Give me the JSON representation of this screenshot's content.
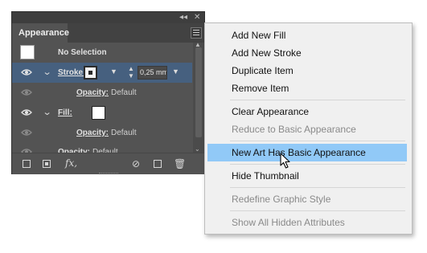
{
  "panel": {
    "tab_label": "Appearance",
    "collapse_glyph": "◂◂",
    "close_glyph": "✕",
    "rows": {
      "selection_label": "No Selection",
      "stroke_label": "Stroke:",
      "stroke_weight": "0,25 mm",
      "stroke_opacity_label": "Opacity:",
      "stroke_opacity_value": "Default",
      "fill_label": "Fill:",
      "fill_opacity_label": "Opacity:",
      "fill_opacity_value": "Default",
      "overall_opacity_label": "Opacity:",
      "overall_opacity_value": "Default"
    },
    "bottom_fx": "fx,"
  },
  "menu": {
    "add_new_fill": "Add New Fill",
    "add_new_stroke": "Add New Stroke",
    "duplicate_item": "Duplicate Item",
    "remove_item": "Remove Item",
    "clear_appearance": "Clear Appearance",
    "reduce_basic": "Reduce to Basic Appearance",
    "new_art_basic": "New Art Has Basic Appearance",
    "hide_thumbnail": "Hide Thumbnail",
    "redefine_style": "Redefine Graphic Style",
    "show_hidden": "Show All Hidden Attributes"
  },
  "colors": {
    "panel_bg": "#535353",
    "selected_row": "#46607f",
    "menu_highlight": "#91c9f7"
  }
}
